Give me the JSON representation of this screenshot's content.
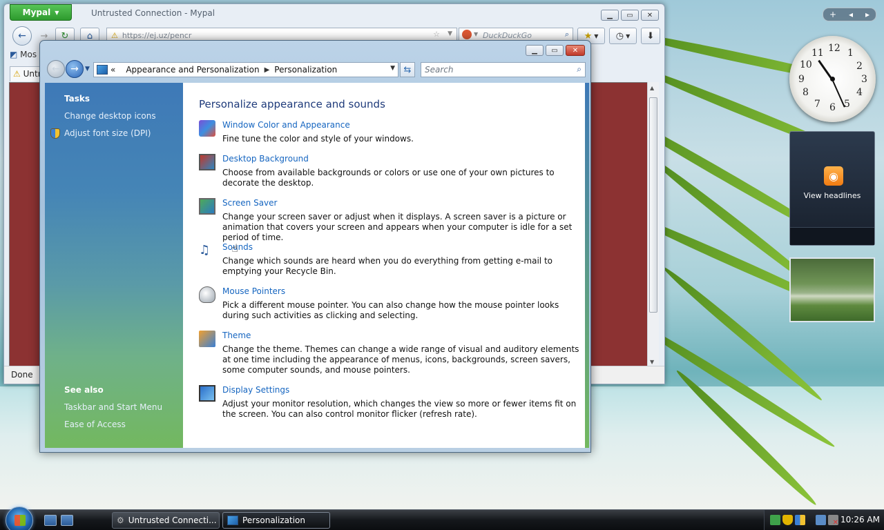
{
  "browser": {
    "app_menu": "Mypal",
    "title": "Untrusted Connection - Mypal",
    "url": "https://ej.uz/pencr",
    "search_placeholder": "DuckDuckGo",
    "bookmark_label": "Mos",
    "tab_label": "Untru",
    "status": "Done",
    "content_color": "#8c3232"
  },
  "control_panel": {
    "breadcrumb_overflow": "«",
    "breadcrumb": [
      "Appearance and Personalization",
      "Personalization"
    ],
    "search_placeholder": "Search",
    "tasks_heading": "Tasks",
    "tasks": [
      "Change desktop icons",
      "Adjust font size (DPI)"
    ],
    "see_also_heading": "See also",
    "see_also": [
      "Taskbar and Start Menu",
      "Ease of Access"
    ],
    "heading": "Personalize appearance and sounds",
    "items": [
      {
        "link": "Window Color and Appearance",
        "desc": "Fine tune the color and style of your windows.",
        "icon": "window-color-icon"
      },
      {
        "link": "Desktop Background",
        "desc": "Choose from available backgrounds or colors or use one of your own pictures to decorate the desktop.",
        "icon": "desktop-background-icon"
      },
      {
        "link": "Screen Saver",
        "desc": "Change your screen saver or adjust when it displays. A screen saver is a picture or animation that covers your screen and appears when your computer is idle for a set period of time.",
        "icon": "screen-saver-icon"
      },
      {
        "link": "Sounds",
        "desc": "Change which sounds are heard when you do everything from getting e-mail to emptying your Recycle Bin.",
        "icon": "sounds-icon"
      },
      {
        "link": "Mouse Pointers",
        "desc": "Pick a different mouse pointer. You can also change how the mouse pointer looks during such activities as clicking and selecting.",
        "icon": "mouse-pointers-icon"
      },
      {
        "link": "Theme",
        "desc": "Change the theme. Themes can change a wide range of visual and auditory elements at one time including the appearance of menus, icons, backgrounds, screen savers, some computer sounds, and mouse pointers.",
        "icon": "theme-icon"
      },
      {
        "link": "Display Settings",
        "desc": "Adjust your monitor resolution, which changes the view so more or fewer items fit on the screen. You can also control monitor flicker (refresh rate).",
        "icon": "display-settings-icon"
      }
    ]
  },
  "gadgets": {
    "clock_numbers": [
      "12",
      "1",
      "2",
      "3",
      "4",
      "5",
      "6",
      "7",
      "8",
      "9",
      "10",
      "11"
    ],
    "feed_label": "View headlines",
    "sidebar_plus": "+"
  },
  "taskbar": {
    "buttons": [
      "Untrusted Connecti...",
      "Personalization"
    ],
    "time": "10:26 AM"
  }
}
